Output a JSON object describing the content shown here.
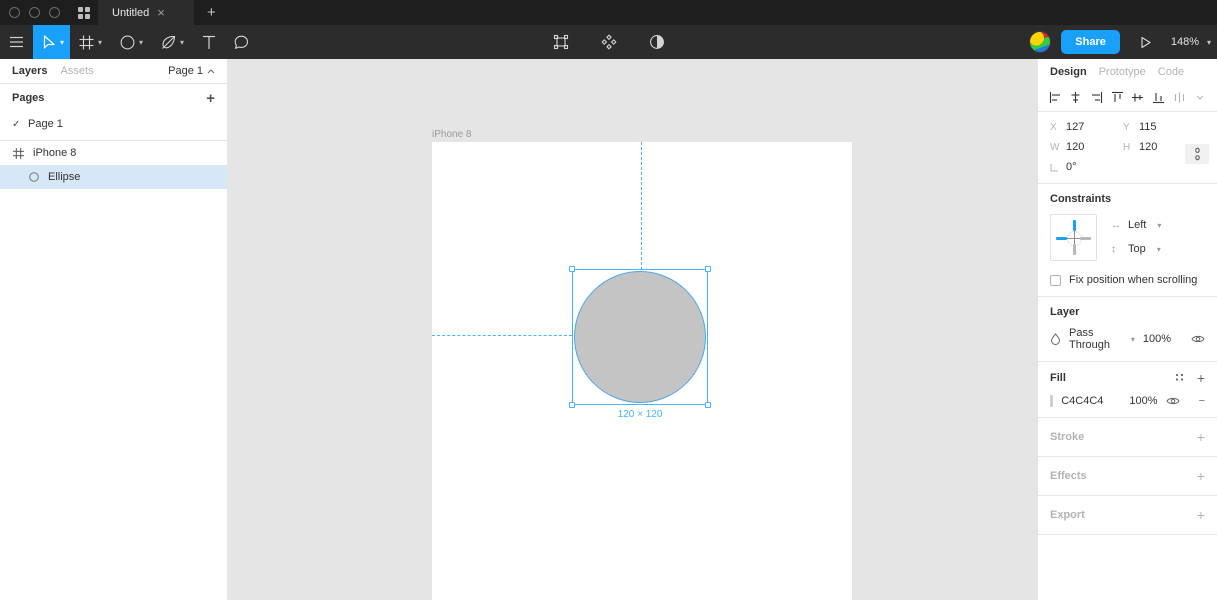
{
  "window": {
    "tab_title": "Untitled",
    "close_label": "×",
    "new_tab_label": "+"
  },
  "toolbar": {
    "menu_icon": "hamburger-menu-icon",
    "move_tool": "move-tool-icon",
    "frame_tool": "frame-tool-icon",
    "shape_tool": "ellipse-tool-icon",
    "pen_tool": "pen-tool-icon",
    "text_tool": "text-tool-icon",
    "comment_tool": "comment-tool-icon",
    "component_icon": "component-icon",
    "plugin_icon": "plugin-icon",
    "mask_icon": "mask-icon",
    "share_label": "Share",
    "present_icon": "present-play-icon",
    "zoom_level": "148%",
    "zoom_chevron": "⌄"
  },
  "left_panel": {
    "tabs": [
      {
        "label": "Layers",
        "active": true
      },
      {
        "label": "Assets",
        "active": false
      }
    ],
    "page_selector": "Page 1",
    "pages_header": "Pages",
    "add_page_label": "+",
    "pages": [
      {
        "label": "Page 1",
        "checked": true
      }
    ],
    "layers": [
      {
        "label": "iPhone 8",
        "icon": "frame-icon",
        "selected": false
      },
      {
        "label": "Ellipse",
        "icon": "ellipse-icon",
        "selected": true
      }
    ]
  },
  "canvas": {
    "frame_label": "iPhone 8",
    "dimension_label": "120 × 120",
    "selection_color": "#4AB3F4",
    "shape_fill": "#C4C4C4",
    "background": "#E5E5E5"
  },
  "right_panel": {
    "tabs": [
      {
        "label": "Design",
        "active": true
      },
      {
        "label": "Prototype",
        "active": false
      },
      {
        "label": "Code",
        "active": false
      }
    ],
    "align_icons": [
      "align-left-icon",
      "align-horizontal-center-icon",
      "align-right-icon",
      "align-top-icon",
      "align-vertical-center-icon",
      "align-bottom-icon",
      "distribute-icon"
    ],
    "transform": {
      "x_label": "X",
      "x_value": "127",
      "y_label": "Y",
      "y_value": "115",
      "w_label": "W",
      "w_value": "120",
      "h_label": "H",
      "h_value": "120",
      "rotation_label": "└",
      "rotation_value": "0°",
      "lock_icon": "proportion-lock-icon"
    },
    "constraints": {
      "title": "Constraints",
      "horizontal_value": "Left",
      "vertical_value": "Top",
      "fix_position_label": "Fix position when scrolling",
      "fix_position_checked": false,
      "active_color": "#18A0FB"
    },
    "layer": {
      "title": "Layer",
      "blend_mode": "Pass Through",
      "opacity": "100%",
      "visibility_icon": "eye-icon"
    },
    "fill": {
      "title": "Fill",
      "style_icon": "fill-style-icon",
      "add_icon": "+",
      "color_hex": "C4C4C4",
      "color_value": "#C4C4C4",
      "opacity": "100%",
      "visibility_icon": "eye-icon",
      "remove_icon": "−"
    },
    "sections": [
      {
        "title": "Stroke",
        "add_label": "+"
      },
      {
        "title": "Effects",
        "add_label": "+"
      },
      {
        "title": "Export",
        "add_label": "+"
      }
    ]
  }
}
